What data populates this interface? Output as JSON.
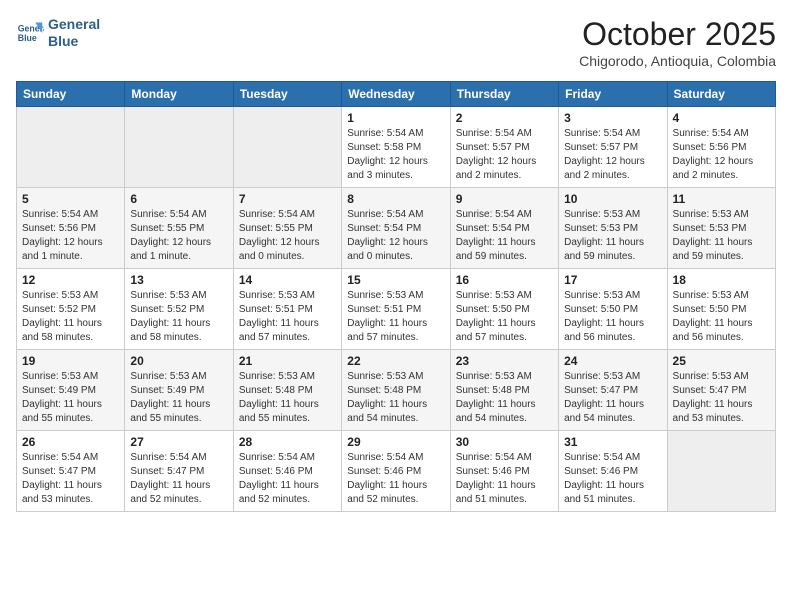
{
  "header": {
    "logo_line1": "General",
    "logo_line2": "Blue",
    "month": "October 2025",
    "location": "Chigorodo, Antioquia, Colombia"
  },
  "weekdays": [
    "Sunday",
    "Monday",
    "Tuesday",
    "Wednesday",
    "Thursday",
    "Friday",
    "Saturday"
  ],
  "weeks": [
    [
      {
        "day": "",
        "info": ""
      },
      {
        "day": "",
        "info": ""
      },
      {
        "day": "",
        "info": ""
      },
      {
        "day": "1",
        "info": "Sunrise: 5:54 AM\nSunset: 5:58 PM\nDaylight: 12 hours and 3 minutes."
      },
      {
        "day": "2",
        "info": "Sunrise: 5:54 AM\nSunset: 5:57 PM\nDaylight: 12 hours and 2 minutes."
      },
      {
        "day": "3",
        "info": "Sunrise: 5:54 AM\nSunset: 5:57 PM\nDaylight: 12 hours and 2 minutes."
      },
      {
        "day": "4",
        "info": "Sunrise: 5:54 AM\nSunset: 5:56 PM\nDaylight: 12 hours and 2 minutes."
      }
    ],
    [
      {
        "day": "5",
        "info": "Sunrise: 5:54 AM\nSunset: 5:56 PM\nDaylight: 12 hours and 1 minute."
      },
      {
        "day": "6",
        "info": "Sunrise: 5:54 AM\nSunset: 5:55 PM\nDaylight: 12 hours and 1 minute."
      },
      {
        "day": "7",
        "info": "Sunrise: 5:54 AM\nSunset: 5:55 PM\nDaylight: 12 hours and 0 minutes."
      },
      {
        "day": "8",
        "info": "Sunrise: 5:54 AM\nSunset: 5:54 PM\nDaylight: 12 hours and 0 minutes."
      },
      {
        "day": "9",
        "info": "Sunrise: 5:54 AM\nSunset: 5:54 PM\nDaylight: 11 hours and 59 minutes."
      },
      {
        "day": "10",
        "info": "Sunrise: 5:53 AM\nSunset: 5:53 PM\nDaylight: 11 hours and 59 minutes."
      },
      {
        "day": "11",
        "info": "Sunrise: 5:53 AM\nSunset: 5:53 PM\nDaylight: 11 hours and 59 minutes."
      }
    ],
    [
      {
        "day": "12",
        "info": "Sunrise: 5:53 AM\nSunset: 5:52 PM\nDaylight: 11 hours and 58 minutes."
      },
      {
        "day": "13",
        "info": "Sunrise: 5:53 AM\nSunset: 5:52 PM\nDaylight: 11 hours and 58 minutes."
      },
      {
        "day": "14",
        "info": "Sunrise: 5:53 AM\nSunset: 5:51 PM\nDaylight: 11 hours and 57 minutes."
      },
      {
        "day": "15",
        "info": "Sunrise: 5:53 AM\nSunset: 5:51 PM\nDaylight: 11 hours and 57 minutes."
      },
      {
        "day": "16",
        "info": "Sunrise: 5:53 AM\nSunset: 5:50 PM\nDaylight: 11 hours and 57 minutes."
      },
      {
        "day": "17",
        "info": "Sunrise: 5:53 AM\nSunset: 5:50 PM\nDaylight: 11 hours and 56 minutes."
      },
      {
        "day": "18",
        "info": "Sunrise: 5:53 AM\nSunset: 5:50 PM\nDaylight: 11 hours and 56 minutes."
      }
    ],
    [
      {
        "day": "19",
        "info": "Sunrise: 5:53 AM\nSunset: 5:49 PM\nDaylight: 11 hours and 55 minutes."
      },
      {
        "day": "20",
        "info": "Sunrise: 5:53 AM\nSunset: 5:49 PM\nDaylight: 11 hours and 55 minutes."
      },
      {
        "day": "21",
        "info": "Sunrise: 5:53 AM\nSunset: 5:48 PM\nDaylight: 11 hours and 55 minutes."
      },
      {
        "day": "22",
        "info": "Sunrise: 5:53 AM\nSunset: 5:48 PM\nDaylight: 11 hours and 54 minutes."
      },
      {
        "day": "23",
        "info": "Sunrise: 5:53 AM\nSunset: 5:48 PM\nDaylight: 11 hours and 54 minutes."
      },
      {
        "day": "24",
        "info": "Sunrise: 5:53 AM\nSunset: 5:47 PM\nDaylight: 11 hours and 54 minutes."
      },
      {
        "day": "25",
        "info": "Sunrise: 5:53 AM\nSunset: 5:47 PM\nDaylight: 11 hours and 53 minutes."
      }
    ],
    [
      {
        "day": "26",
        "info": "Sunrise: 5:54 AM\nSunset: 5:47 PM\nDaylight: 11 hours and 53 minutes."
      },
      {
        "day": "27",
        "info": "Sunrise: 5:54 AM\nSunset: 5:47 PM\nDaylight: 11 hours and 52 minutes."
      },
      {
        "day": "28",
        "info": "Sunrise: 5:54 AM\nSunset: 5:46 PM\nDaylight: 11 hours and 52 minutes."
      },
      {
        "day": "29",
        "info": "Sunrise: 5:54 AM\nSunset: 5:46 PM\nDaylight: 11 hours and 52 minutes."
      },
      {
        "day": "30",
        "info": "Sunrise: 5:54 AM\nSunset: 5:46 PM\nDaylight: 11 hours and 51 minutes."
      },
      {
        "day": "31",
        "info": "Sunrise: 5:54 AM\nSunset: 5:46 PM\nDaylight: 11 hours and 51 minutes."
      },
      {
        "day": "",
        "info": ""
      }
    ]
  ]
}
